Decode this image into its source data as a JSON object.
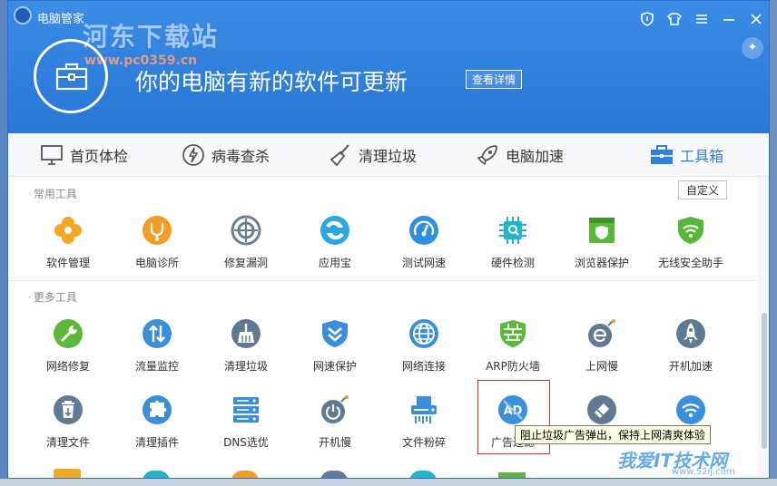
{
  "window": {
    "title": "电脑管家",
    "watermark": "河东下载站",
    "watermark_url": "www.pc0359.cn",
    "headline": "你的电脑有新的软件可更新",
    "details_button": "查看详情"
  },
  "tabs": [
    {
      "label": "首页体检"
    },
    {
      "label": "病毒查杀"
    },
    {
      "label": "清理垃圾"
    },
    {
      "label": "电脑加速"
    },
    {
      "label": "工具箱"
    }
  ],
  "sections": {
    "common": "常用工具",
    "more": "更多工具",
    "customize": "自定义"
  },
  "common_tools": [
    {
      "label": "软件管理",
      "color": "#f5a623"
    },
    {
      "label": "电脑诊所",
      "color": "#f39c26"
    },
    {
      "label": "修复漏洞",
      "color": "#6a7f95"
    },
    {
      "label": "应用宝",
      "color": "#2aa8e0"
    },
    {
      "label": "测试网速",
      "color": "#2f8fe0"
    },
    {
      "label": "硬件检测",
      "color": "#22b5c9"
    },
    {
      "label": "浏览器保护",
      "color": "#55b837"
    },
    {
      "label": "无线安全助手",
      "color": "#55b837"
    }
  ],
  "more_tools_row1": [
    {
      "label": "网络修复",
      "color": "#5cb83a"
    },
    {
      "label": "流量监控",
      "color": "#3a8fdc"
    },
    {
      "label": "清理垃圾",
      "color": "#5f7a94"
    },
    {
      "label": "网速保护",
      "color": "#3a8fdc"
    },
    {
      "label": "网络连接",
      "color": "#3a8fdc"
    },
    {
      "label": "ARP防火墙",
      "color": "#5cb83a"
    },
    {
      "label": "上网慢",
      "color": "#5f7a94"
    },
    {
      "label": "开机加速",
      "color": "#5f7a94"
    }
  ],
  "more_tools_row2": [
    {
      "label": "清理文件",
      "color": "#5f7a94"
    },
    {
      "label": "清理插件",
      "color": "#3a8fdc"
    },
    {
      "label": "DNS选优",
      "color": "#3a8fdc"
    },
    {
      "label": "开机慢",
      "color": "#5f7a94"
    },
    {
      "label": "文件粉碎",
      "color": "#3a8fdc"
    },
    {
      "label": "广告过滤",
      "color": "#3a8fdc"
    },
    {
      "label": "",
      "color": "#5f7a94"
    },
    {
      "label": "",
      "color": "#3a8fdc"
    }
  ],
  "tooltip": "阻止垃圾广告弹出，保持上网清爽体验",
  "bottom_watermark": "我爱IT技术网",
  "bottom_watermark_url": "www.52ij.com"
}
